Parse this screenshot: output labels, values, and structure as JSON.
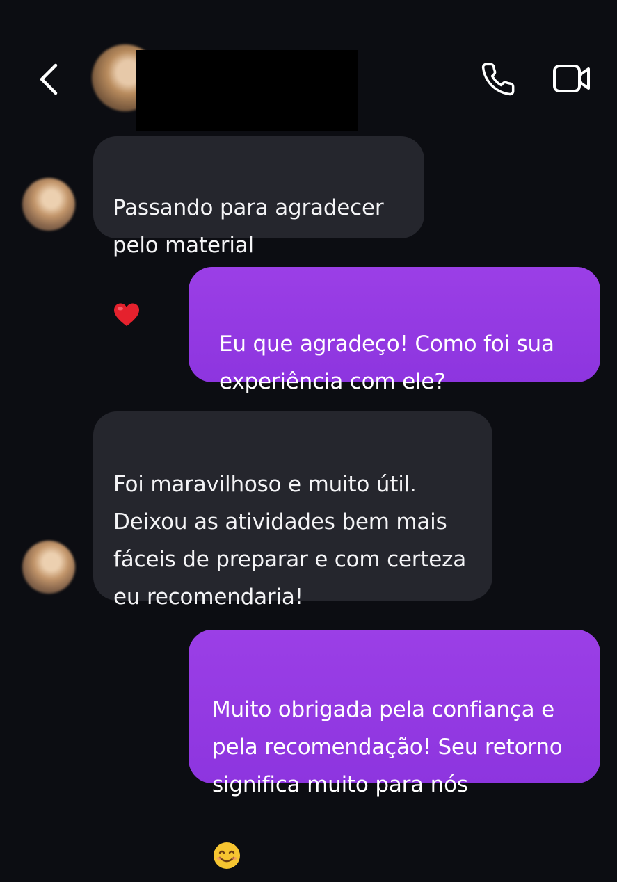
{
  "header": {
    "back_icon": "chevron-left-icon",
    "call_icon": "phone-icon",
    "video_icon": "video-camera-icon"
  },
  "messages": [
    {
      "direction": "in",
      "text": "Passando para agradecer\npelo material",
      "emoji": "heart"
    },
    {
      "direction": "out",
      "text": "Eu que agradeço! Como foi sua\nexperiência com ele?"
    },
    {
      "direction": "in",
      "text": "Foi maravilhoso e muito útil.\nDeixou as atividades bem mais\nfáceis de preparar e com certeza\neu recomendaria!"
    },
    {
      "direction": "out",
      "text": "Muito obrigada pela confiança e\npela recomendação! Seu retorno\nsignifica muito para nós",
      "emoji": "smiling-face"
    }
  ],
  "colors": {
    "background": "#0c0d12",
    "incoming_bubble": "#25262d",
    "outgoing_bubble": "#9038e2"
  }
}
